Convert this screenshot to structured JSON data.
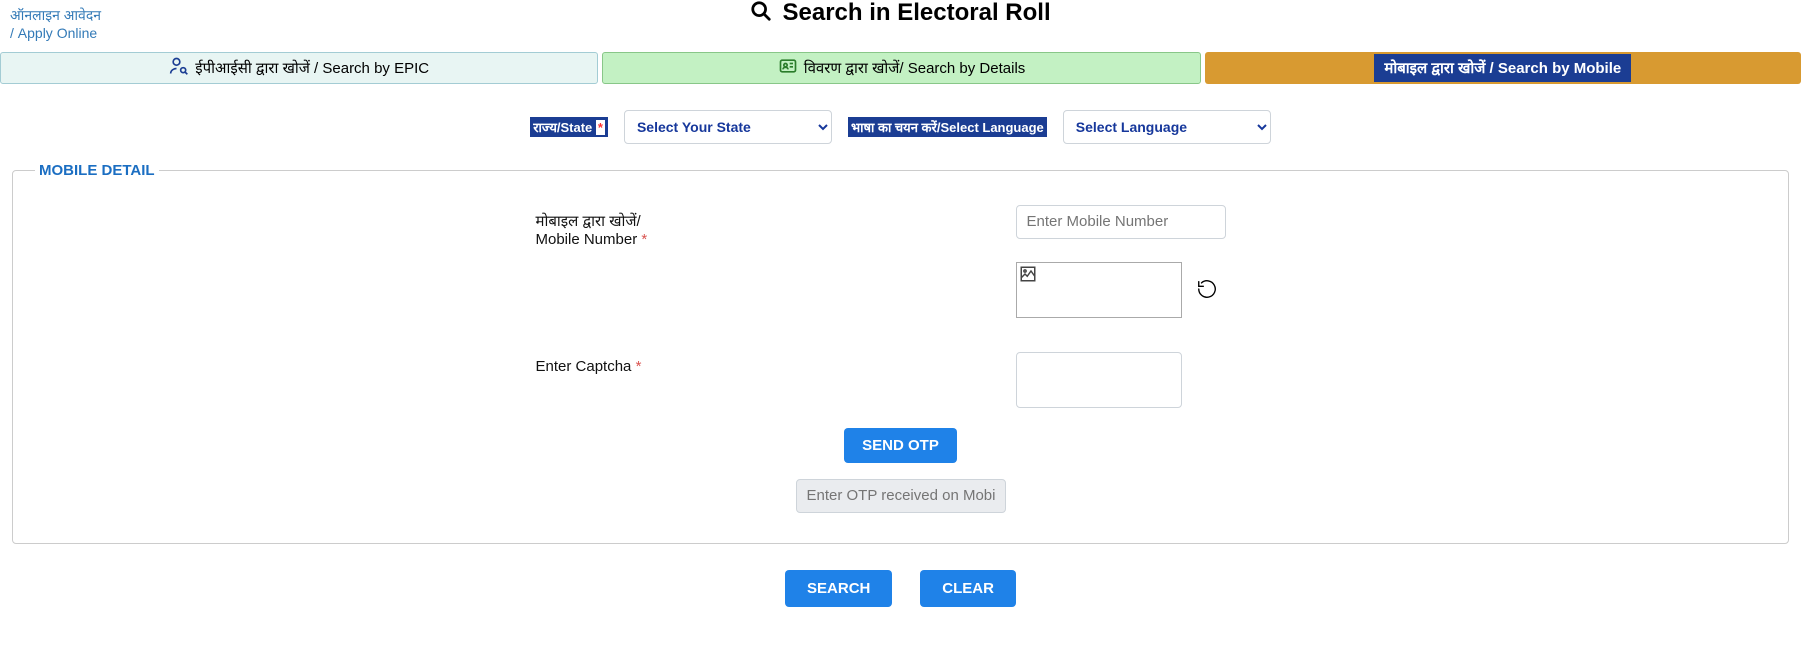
{
  "header": {
    "apply_link_hi": "ऑनलाइन आवेदन",
    "apply_link_en": "/ Apply Online",
    "title": "Search in Electoral Roll"
  },
  "tabs": {
    "epic": "ईपीआईसी द्वारा खोजें / Search by EPIC",
    "details": "विवरण द्वारा खोजें/ Search by Details",
    "mobile": "मोबाइल द्वारा खोजें / Search by Mobile"
  },
  "selectors": {
    "state_label": "राज्य/State",
    "state_placeholder": "Select Your State",
    "language_label": "भाषा का चयन करें/Select Language",
    "language_placeholder": "Select Language"
  },
  "fieldset": {
    "legend": "MOBILE DETAIL"
  },
  "form": {
    "mobile_label_hi": "मोबाइल द्वारा खोजें/",
    "mobile_label_en": "Mobile Number",
    "mobile_placeholder": "Enter Mobile Number",
    "captcha_label": "Enter Captcha",
    "send_otp_btn": "SEND OTP",
    "otp_placeholder": "Enter OTP received on Mobile"
  },
  "buttons": {
    "search": "SEARCH",
    "clear": "CLEAR"
  }
}
